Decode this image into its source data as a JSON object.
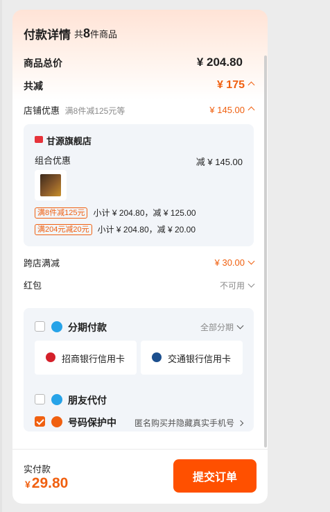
{
  "header": {
    "title": "付款详情",
    "count_prefix": "共",
    "count": "8",
    "count_suffix": "件商品"
  },
  "summary": {
    "total_label": "商品总价",
    "total_value": "¥ 204.80",
    "discount_label": "共减",
    "discount_value": "¥ 175"
  },
  "store_discount": {
    "label": "店铺优惠",
    "hint": "满8件减125元等",
    "value": "¥ 145.00",
    "store_name": "甘源旗舰店",
    "combo_label": "组合优惠",
    "combo_value": "减 ¥ 145.00",
    "promos": [
      {
        "tag": "满8件减125元",
        "text": "小计 ¥ 204.80，减 ¥ 125.00"
      },
      {
        "tag": "满204元减20元",
        "text": "小计 ¥ 204.80，减 ¥ 20.00"
      }
    ]
  },
  "cross_store": {
    "label": "跨店满减",
    "value": "¥ 30.00"
  },
  "red_packet": {
    "label": "红包",
    "value": "不可用"
  },
  "payment": {
    "installment_label": "分期付款",
    "installment_option": "全部分期",
    "banks": [
      {
        "label": "招商银行信用卡"
      },
      {
        "label": "交通银行信用卡"
      }
    ],
    "friend_pay_label": "朋友代付",
    "privacy_label": "号码保护中",
    "privacy_desc": "匿名购买并隐藏真实手机号"
  },
  "footer": {
    "paid_label": "实付款",
    "paid_symbol": "¥",
    "paid_amount": "29.80",
    "submit_label": "提交订单"
  },
  "colors": {
    "accent": "#ff5000",
    "price": "#f06010"
  }
}
